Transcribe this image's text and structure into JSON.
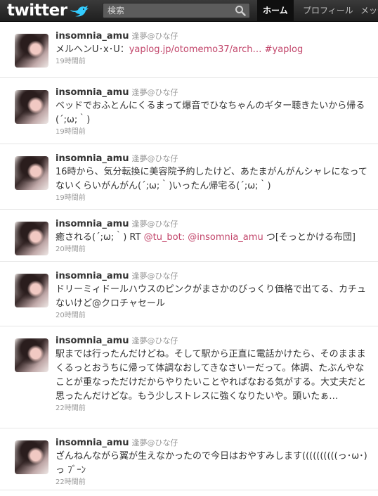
{
  "header": {
    "logo": "twitter",
    "search_placeholder": "検索",
    "nav": {
      "home": "ホーム",
      "profile": "プロフィール",
      "messages": "メッセ"
    }
  },
  "tweets": [
    {
      "screen_name": "insomnia_amu",
      "full_name": "逢夢@ひな仔",
      "parts": [
        {
          "t": "メルヘンU･x･U：",
          "link": false
        },
        {
          "t": "yaplog.jp/otomemo37/arch…",
          "link": true
        },
        {
          "t": " ",
          "link": false
        },
        {
          "t": "#yaplog",
          "link": true
        }
      ],
      "time": "19時間前"
    },
    {
      "screen_name": "insomnia_amu",
      "full_name": "逢夢@ひな仔",
      "parts": [
        {
          "t": "ベッドでおふとんにくるまって爆音でひなちゃんのギター聴きたいから帰る(´;ω;｀)",
          "link": false
        }
      ],
      "time": "19時間前"
    },
    {
      "screen_name": "insomnia_amu",
      "full_name": "逢夢@ひな仔",
      "parts": [
        {
          "t": "16時から、気分転換に美容院予約したけど、あたまがんがんシャレになってないくらいがんがん(´;ω;｀)いったん帰宅る(´;ω;｀)",
          "link": false
        }
      ],
      "time": "19時間前"
    },
    {
      "screen_name": "insomnia_amu",
      "full_name": "逢夢@ひな仔",
      "parts": [
        {
          "t": "癒される(´;ω;｀) RT ",
          "link": false
        },
        {
          "t": "@tu_bot",
          "link": true
        },
        {
          "t": ": ",
          "link": true
        },
        {
          "t": "@insomnia_amu",
          "link": true
        },
        {
          "t": " つ[そっとかける布団]",
          "link": false
        }
      ],
      "time": "20時間前"
    },
    {
      "screen_name": "insomnia_amu",
      "full_name": "逢夢@ひな仔",
      "parts": [
        {
          "t": "ドリーミィドールハウスのピンクがまさかのびっくり価格で出てる、カチュないけど@クロチャセール",
          "link": false
        }
      ],
      "time": "20時間前"
    },
    {
      "screen_name": "insomnia_amu",
      "full_name": "逢夢@ひな仔",
      "parts": [
        {
          "t": "駅までは行ったんだけどね。そして駅から正直に電話かけたら、そのまままくるっとおうちに帰って体調なおしてきなさいーだって。体調、たぶんやなことが重なっただけだからやりたいことやればなおる気がする。大丈夫だと思ったんだけどな。もう少しストレスに強くなりたいや。頭いたぁ…",
          "link": false
        }
      ],
      "time": "22時間前"
    },
    {
      "screen_name": "insomnia_amu",
      "full_name": "逢夢@ひな仔",
      "parts": [
        {
          "t": "ざんねんながら翼が生えなかったので今日はおやすみします((((((((((っ･ω･)っ ﾌﾞｰﾝ",
          "link": false
        }
      ],
      "time": "22時間前"
    }
  ]
}
